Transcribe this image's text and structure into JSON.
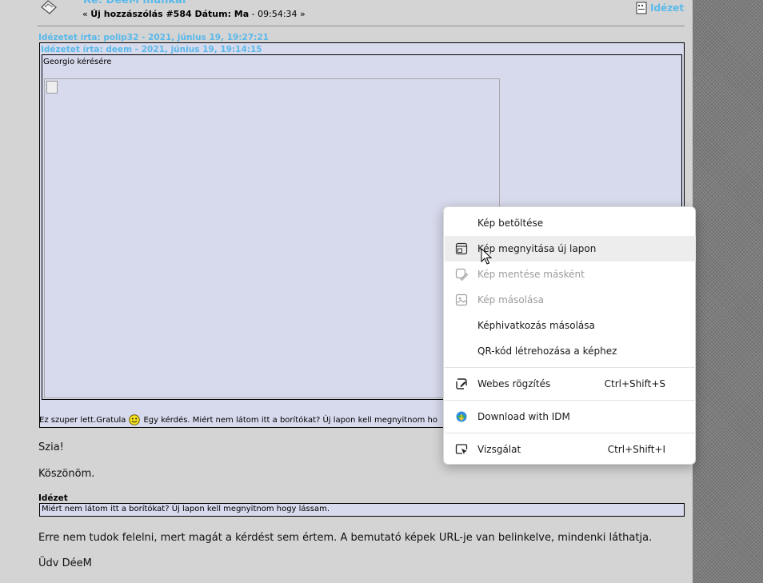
{
  "post": {
    "title": "Re: DeeM munkái",
    "meta_prefix": "«",
    "meta_bold": "Új hozzászólás #584 Dátum: Ma",
    "meta_rest": "- 09:54:34 »",
    "quote_button": "Idézet"
  },
  "quotes": {
    "outer_header": "Idézetet írta: polip32 - 2021, június 19, 19:27:21",
    "inner_header": "Idézetet írta: deem - 2021, június 19, 19:14:15",
    "inner_text": "Georgio kérésére",
    "outer_text_a": "Ez szuper lett.Gratula",
    "outer_text_b": "Egy kérdés. Miért nem látom itt a  borítókat? Új lapon kell megnyitnom ho"
  },
  "body": {
    "line1": "Szia!",
    "line2": "Köszönöm.",
    "quote_label": "Idézet",
    "quote_text": "Miért nem látom itt a  borítókat? Új lapon kell megnyitnom hogy lássam.",
    "line3": "Erre nem tudok felelni, mert magát a kérdést sem értem. A bemutató képek URL-je van belinkelve, mindenki láthatja.",
    "line4": "Üdv DéeM"
  },
  "context_menu": {
    "items": [
      {
        "label": "Kép betöltése",
        "icon": "none",
        "state": "normal"
      },
      {
        "label": "Kép megnyitása új lapon",
        "icon": "new-tab-image-icon",
        "state": "hover"
      },
      {
        "label": "Kép mentése másként",
        "icon": "save-image-icon",
        "state": "disabled"
      },
      {
        "label": "Kép másolása",
        "icon": "copy-image-icon",
        "state": "disabled"
      },
      {
        "label": "Képhivatkozás másolása",
        "icon": "none",
        "state": "normal"
      },
      {
        "label": "QR-kód létrehozása a képhez",
        "icon": "none",
        "state": "normal"
      },
      {
        "label": "Webes rögzítés",
        "shortcut": "Ctrl+Shift+S",
        "icon": "web-capture-icon",
        "state": "normal"
      },
      {
        "label": "Download with IDM",
        "icon": "idm-icon",
        "state": "normal"
      },
      {
        "label": "Vizsgálat",
        "shortcut": "Ctrl+Shift+I",
        "icon": "inspect-icon",
        "state": "normal"
      }
    ]
  },
  "colors": {
    "link_blue": "#5ab9ea",
    "quote_bg": "#d7d9ec",
    "page_bg": "#d4d4d4",
    "menu_hover": "#ededed",
    "menu_disabled": "#9c9c9c"
  }
}
